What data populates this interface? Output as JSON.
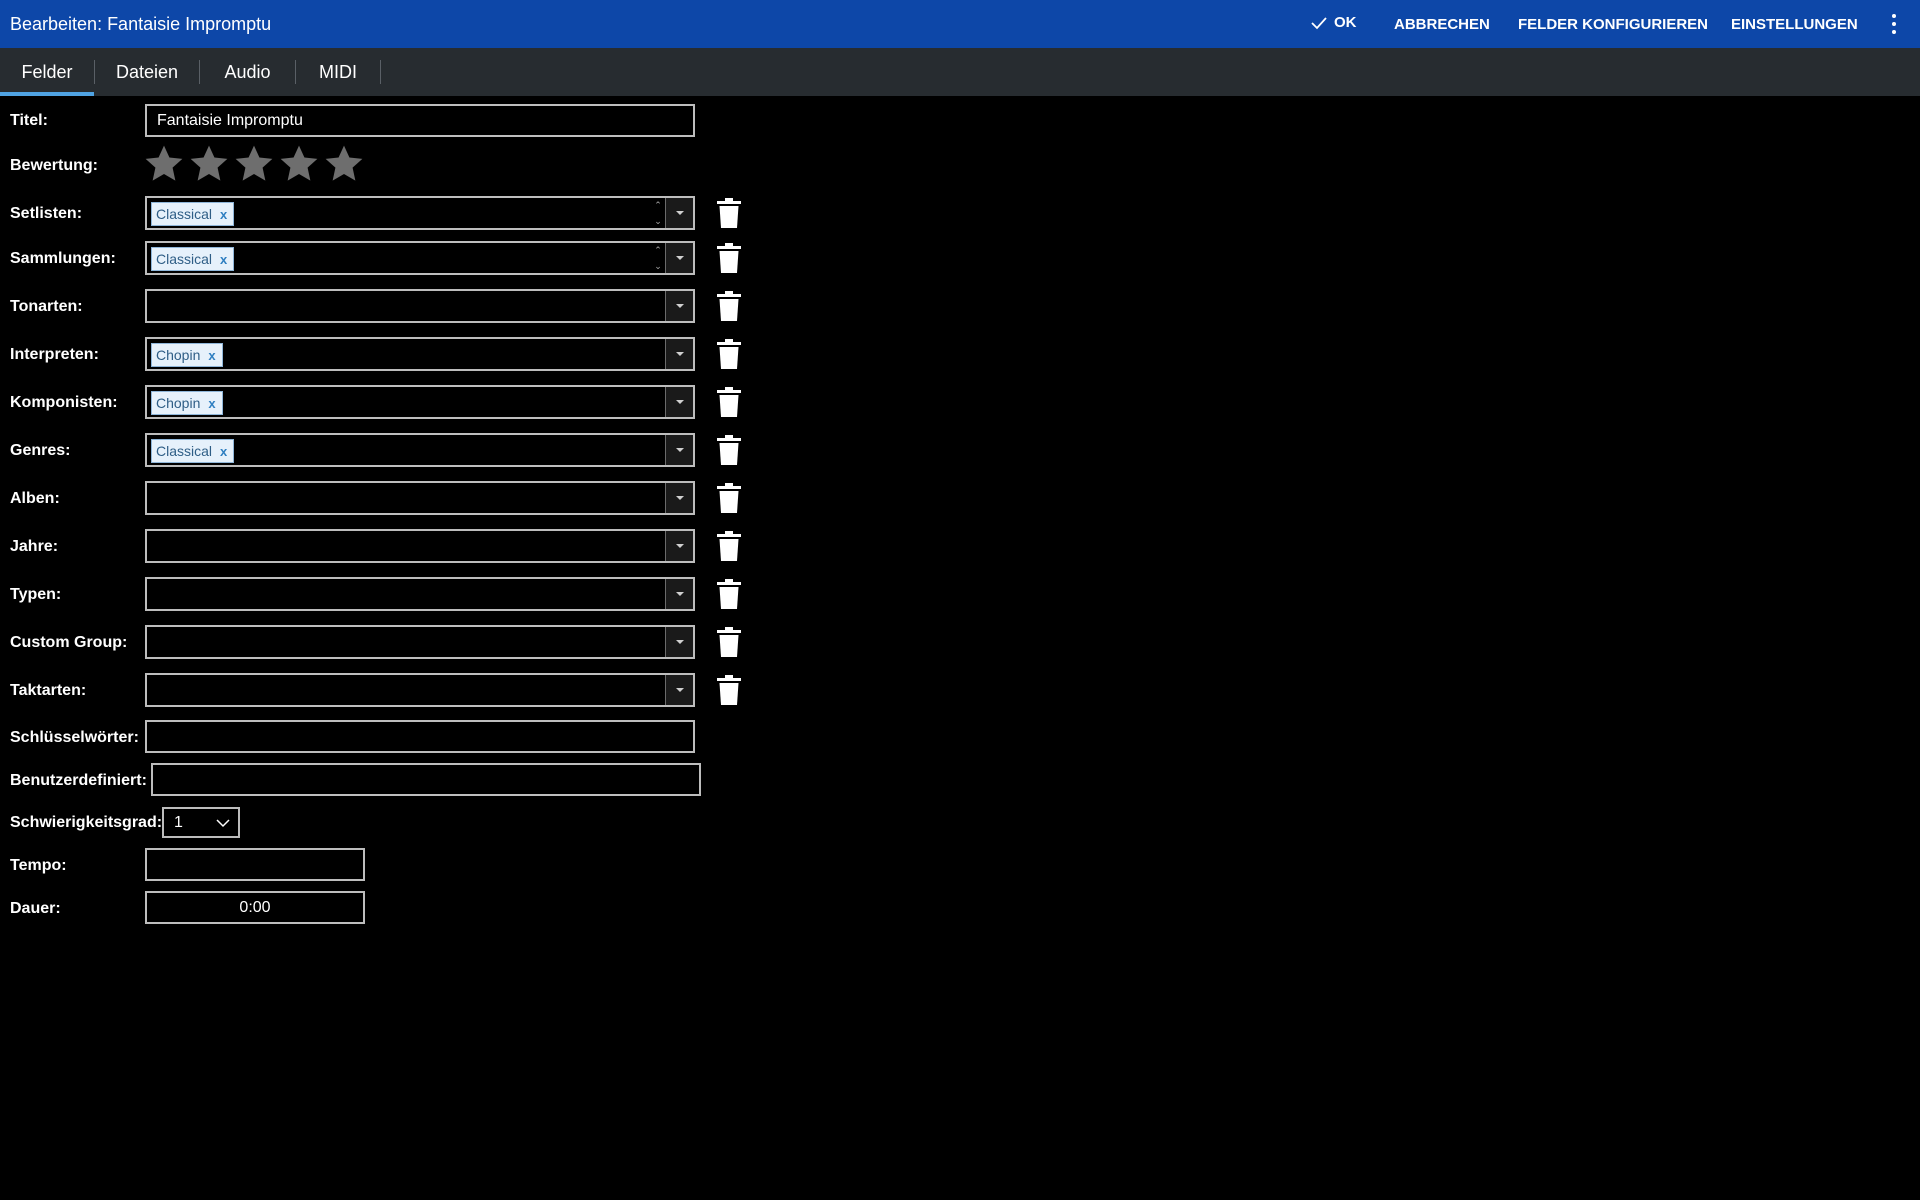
{
  "header": {
    "title": "Bearbeiten: Fantaisie Impromptu",
    "ok_label": "OK",
    "cancel_label": "ABBRECHEN",
    "configure_label": "FELDER KONFIGURIEREN",
    "settings_label": "EINSTELLUNGEN"
  },
  "tabs": [
    {
      "label": "Felder",
      "active": true
    },
    {
      "label": "Dateien",
      "active": false
    },
    {
      "label": "Audio",
      "active": false
    },
    {
      "label": "MIDI",
      "active": false
    }
  ],
  "form": {
    "title": {
      "label": "Titel:",
      "value": "Fantaisie Impromptu"
    },
    "rating": {
      "label": "Bewertung:",
      "stars_filled": 0,
      "stars_total": 5
    },
    "setlists": {
      "label": "Setlisten:",
      "chip": "Classical",
      "chip_remove": "x"
    },
    "collections": {
      "label": "Sammlungen:",
      "chip": "Classical",
      "chip_remove": "x"
    },
    "keys": {
      "label": "Tonarten:"
    },
    "performers": {
      "label": "Interpreten:",
      "chip": "Chopin",
      "chip_remove": "x"
    },
    "composers": {
      "label": "Komponisten:",
      "chip": "Chopin",
      "chip_remove": "x"
    },
    "genres": {
      "label": "Genres:",
      "chip": "Classical",
      "chip_remove": "x"
    },
    "albums": {
      "label": "Alben:"
    },
    "years": {
      "label": "Jahre:"
    },
    "types": {
      "label": "Typen:"
    },
    "custom_group": {
      "label": "Custom Group:"
    },
    "time_signatures": {
      "label": "Taktarten:"
    },
    "keywords": {
      "label": "Schlüsselwörter:",
      "value": ""
    },
    "custom": {
      "label": "Benutzerdefiniert:",
      "value": ""
    },
    "difficulty": {
      "label": "Schwierigkeitsgrad:",
      "value": "1"
    },
    "tempo": {
      "label": "Tempo:",
      "value": ""
    },
    "duration": {
      "label": "Dauer:",
      "value": "0:00"
    }
  },
  "colors": {
    "titlebar": "#0d47a8",
    "tabbar": "#272c30",
    "tab_indicator": "#4fa3e3",
    "star": "#6e6e6e",
    "chip_bg": "#e6f1fb"
  }
}
